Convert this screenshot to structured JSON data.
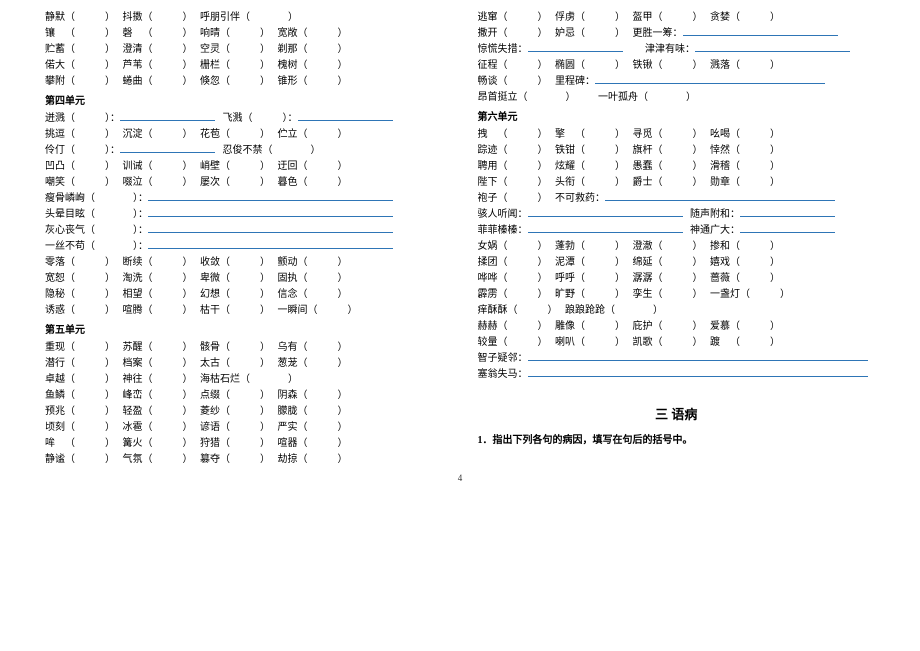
{
  "left_top": [
    {
      "items": [
        "静默",
        "抖擞",
        "呼朋引伴"
      ]
    },
    {
      "items": [
        "镶",
        "磬",
        "响晴",
        "",
        "宽敞"
      ]
    },
    {
      "items": [
        "贮蓄",
        "澄清",
        "空灵",
        "",
        "剃那"
      ]
    },
    {
      "items": [
        "偌大",
        "芦苇",
        "栅栏",
        "",
        "槐树"
      ]
    },
    {
      "items": [
        "攀附",
        "蜷曲",
        "倏忽",
        "",
        "锥形"
      ]
    }
  ],
  "unit4": {
    "title": "第四单元"
  },
  "u4_line1": {
    "a": "迸溅",
    "b": "飞溅"
  },
  "u4r": [
    {
      "items": [
        "挑逗",
        "沉淀",
        "花苞",
        "",
        "伫立"
      ]
    }
  ],
  "u4_line2": {
    "a": "伶仃",
    "colon": "）：",
    "b": "忍俊不禁"
  },
  "u4_tail": [
    {
      "items": [
        "凹凸",
        "训诫",
        "峭壁",
        "",
        "迂回"
      ]
    },
    {
      "items": [
        "嘲笑",
        "啜泣",
        "屡次",
        "",
        "暮色"
      ]
    }
  ],
  "u4_colon": [
    "瘦骨嶙峋",
    "头晕目眩",
    "灰心丧气",
    "一丝不苟"
  ],
  "u4_tail2": [
    {
      "items": [
        "零落",
        "断续",
        "收敛",
        "",
        "颤动"
      ]
    },
    {
      "items": [
        "宽恕",
        "淘洗",
        "卑微",
        "",
        "固执"
      ]
    },
    {
      "items": [
        "隐秘",
        "相望",
        "幻想",
        "",
        "信念"
      ]
    },
    {
      "items": [
        "诱惑",
        "喧腾",
        "枯干",
        "",
        "一瞬间"
      ]
    }
  ],
  "unit5": {
    "title": "第五单元"
  },
  "u5": [
    {
      "items": [
        "重现",
        "苏醒",
        "骸骨",
        "",
        "乌有"
      ]
    },
    {
      "items": [
        "潜行",
        "档案",
        "太古",
        "",
        "葱茏"
      ]
    },
    {
      "items": [
        "卓越",
        "神往",
        "海枯石烂"
      ]
    },
    {
      "items": [
        "鱼鳞",
        "峰峦",
        "点缀",
        "",
        "阴森"
      ]
    },
    {
      "items": [
        "预兆",
        "轻盈",
        "菱纱",
        "",
        "朦胧"
      ]
    },
    {
      "items": [
        "顷刻",
        "冰雹",
        "谚语",
        "",
        "严实"
      ]
    },
    {
      "items": [
        "哞",
        "篝火",
        "狩猎",
        "",
        "喧器"
      ]
    },
    {
      "items": [
        "静谧",
        "气氛",
        "篡夺",
        "",
        "劫掠"
      ]
    }
  ],
  "right_top": [
    {
      "items": [
        "逃窜",
        "俘虏",
        "盔甲",
        "",
        "贪婪"
      ]
    }
  ],
  "right_mix": [
    {
      "a": "撒开",
      "b": "妒忌",
      "tail": "更胜一筹："
    },
    {
      "a": "惊慌失措：",
      "full": true
    },
    {
      "a": "征程",
      "b": "椭圆",
      "c": "铁锹",
      "d": "溅落"
    },
    {
      "a": "畅谈",
      "b": "里程碑：",
      "longtail": true
    },
    {
      "a": "昂首挺立",
      "gap": true,
      "b": "一叶孤舟"
    }
  ],
  "unit6": {
    "title": "第六单元"
  },
  "u6a": [
    {
      "items": [
        "拽",
        "擎",
        "寻觅",
        "",
        "吆喝"
      ]
    },
    {
      "items": [
        "踪迹",
        "铁钳",
        "旗杆",
        "",
        "悻然"
      ]
    },
    {
      "items": [
        "聘用",
        "炫耀",
        "愚蠢",
        "",
        "滑稽"
      ]
    },
    {
      "items": [
        "陛下",
        "头衔",
        "爵士",
        "",
        "勋章"
      ]
    }
  ],
  "u6_mix": [
    {
      "a": "袍子",
      "b": "不可救药："
    },
    {
      "a": "骇人听闻：",
      "full": true,
      "tail": "随声附和："
    },
    {
      "a": "菲菲榛榛：",
      "full": true,
      "tail": "神通广大："
    }
  ],
  "u6b": [
    {
      "items": [
        "女娲",
        "蓬勃",
        "澄澈",
        "",
        "掺和"
      ]
    },
    {
      "items": [
        "揉团",
        "泥潭",
        "绵延",
        "",
        "嬉戏"
      ]
    },
    {
      "items": [
        "哗哗",
        "呼呼",
        "潺潺",
        "",
        "蔷薇"
      ]
    },
    {
      "items": [
        "霹雳",
        "旷野",
        "孪生",
        "",
        "一盏灯"
      ]
    }
  ],
  "u6_line": {
    "a": "痒酥酥",
    "b": "踉踉跄跄"
  },
  "u6c": [
    {
      "items": [
        "赫赫",
        "雕像",
        "庇护",
        "",
        "爱慕"
      ]
    },
    {
      "items": [
        "较量",
        "喇叭",
        "凯歌",
        "",
        "踱"
      ]
    }
  ],
  "u6_end": [
    "智子疑邻：",
    "塞翁失马："
  ],
  "section": "三 语病",
  "instruction": "1．指出下列各句的病因，填写在句后的括号中。",
  "page": "4"
}
